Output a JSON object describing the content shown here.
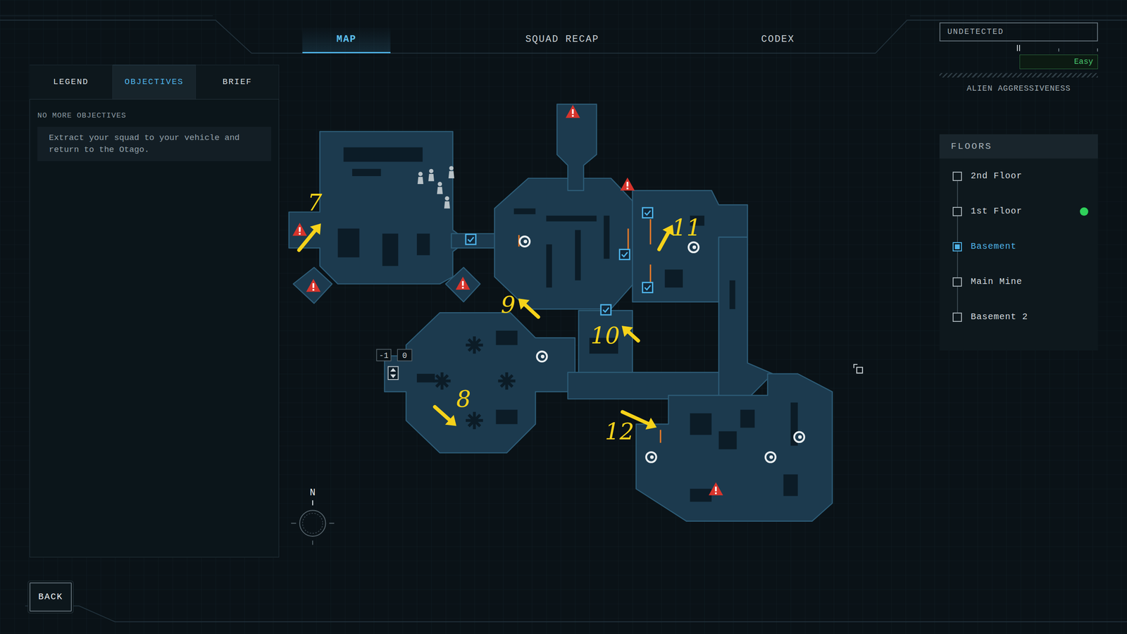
{
  "nav_tabs": [
    {
      "label": "MAP",
      "selected": true
    },
    {
      "label": "SQUAD RECAP",
      "selected": false
    },
    {
      "label": "CODEX",
      "selected": false
    }
  ],
  "detection": {
    "status": "UNDETECTED"
  },
  "aggressiveness": {
    "level": 0.5,
    "difficulty": "Easy",
    "label": "ALIEN AGGRESSIVENESS"
  },
  "side_tabs": [
    {
      "label": "LEGEND",
      "selected": false
    },
    {
      "label": "OBJECTIVES",
      "selected": true
    },
    {
      "label": "BRIEF",
      "selected": false
    }
  ],
  "objectives": {
    "heading": "NO MORE OBJECTIVES",
    "items": [
      "Extract your squad to your vehicle and return to the Otago."
    ]
  },
  "floors": {
    "title": "FLOORS",
    "items": [
      {
        "label": "2nd Floor",
        "selected": false,
        "squad_here": false
      },
      {
        "label": "1st Floor",
        "selected": false,
        "squad_here": true
      },
      {
        "label": "Basement",
        "selected": true,
        "squad_here": false
      },
      {
        "label": "Main Mine",
        "selected": false,
        "squad_here": false
      },
      {
        "label": "Basement 2",
        "selected": false,
        "squad_here": false
      }
    ]
  },
  "map": {
    "compass": "N",
    "elevator_levels": [
      "-1",
      "0"
    ],
    "annotations": [
      {
        "label": "7"
      },
      {
        "label": "8"
      },
      {
        "label": "9"
      },
      {
        "label": "10"
      },
      {
        "label": "11"
      },
      {
        "label": "12"
      }
    ]
  },
  "back_button": "BACK"
}
